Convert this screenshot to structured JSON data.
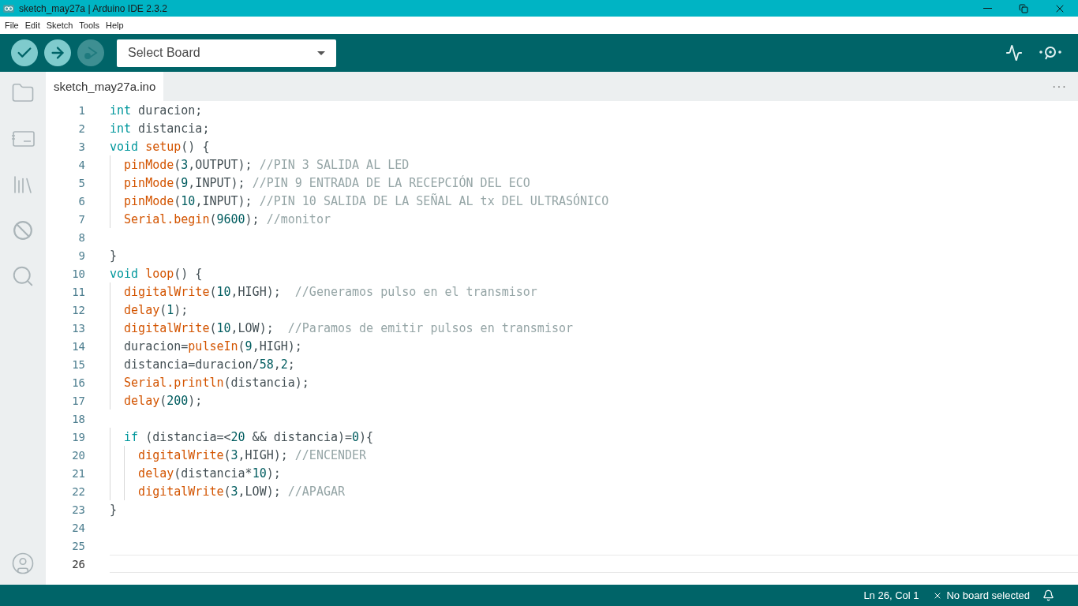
{
  "window": {
    "title": "sketch_may27a | Arduino IDE 2.3.2"
  },
  "menu": [
    "File",
    "Edit",
    "Sketch",
    "Tools",
    "Help"
  ],
  "toolbar": {
    "board_select": "Select Board"
  },
  "tabs": [
    {
      "label": "sketch_may27a.ino",
      "selected": true
    }
  ],
  "tab_bar_more": "···",
  "editor": {
    "lines": [
      {
        "number": "1",
        "current": false,
        "tokens": [
          {
            "kind": "keyword",
            "text": "int"
          },
          {
            "kind": "plain",
            "text": " duracion;"
          }
        ]
      },
      {
        "number": "2",
        "current": false,
        "tokens": [
          {
            "kind": "keyword",
            "text": "int"
          },
          {
            "kind": "plain",
            "text": " distancia;"
          }
        ]
      },
      {
        "number": "3",
        "current": false,
        "tokens": [
          {
            "kind": "keyword",
            "text": "void "
          },
          {
            "kind": "function",
            "text": "setup"
          },
          {
            "kind": "plain",
            "text": "() {"
          }
        ]
      },
      {
        "number": "4",
        "current": false,
        "tokens": [
          {
            "kind": "function",
            "text": "  pinMode"
          },
          {
            "kind": "plain",
            "text": "("
          },
          {
            "kind": "number",
            "text": "3"
          },
          {
            "kind": "plain",
            "text": ",OUTPUT); "
          },
          {
            "kind": "comment",
            "text": "//PIN 3 SALIDA AL LED"
          }
        ]
      },
      {
        "number": "5",
        "current": false,
        "tokens": [
          {
            "kind": "function",
            "text": "  pinMode"
          },
          {
            "kind": "plain",
            "text": "("
          },
          {
            "kind": "number",
            "text": "9"
          },
          {
            "kind": "plain",
            "text": ",INPUT); "
          },
          {
            "kind": "comment",
            "text": "//PIN 9 ENTRADA DE LA RECEPCIÓN DEL ECO"
          }
        ]
      },
      {
        "number": "6",
        "current": false,
        "tokens": [
          {
            "kind": "function",
            "text": "  pinMode"
          },
          {
            "kind": "plain",
            "text": "("
          },
          {
            "kind": "number",
            "text": "10"
          },
          {
            "kind": "plain",
            "text": ",INPUT); "
          },
          {
            "kind": "comment",
            "text": "//PIN 10 SALIDA DE LA SEÑAL AL tx DEL ULTRASÓNICO"
          }
        ]
      },
      {
        "number": "7",
        "current": false,
        "tokens": [
          {
            "kind": "function",
            "text": "  Serial.begin"
          },
          {
            "kind": "plain",
            "text": "("
          },
          {
            "kind": "number",
            "text": "9600"
          },
          {
            "kind": "plain",
            "text": "); "
          },
          {
            "kind": "comment",
            "text": "//monitor"
          }
        ]
      },
      {
        "number": "8",
        "current": false
      },
      {
        "number": "9",
        "current": false,
        "tokens": [
          {
            "kind": "plain",
            "text": "}"
          }
        ]
      },
      {
        "number": "10",
        "current": false,
        "tokens": [
          {
            "kind": "keyword",
            "text": "void "
          },
          {
            "kind": "function",
            "text": "loop"
          },
          {
            "kind": "plain",
            "text": "() {"
          }
        ]
      },
      {
        "number": "11",
        "current": false,
        "tokens": [
          {
            "kind": "function",
            "text": "  digitalWrite"
          },
          {
            "kind": "plain",
            "text": "("
          },
          {
            "kind": "number",
            "text": "10"
          },
          {
            "kind": "plain",
            "text": ",HIGH);  "
          },
          {
            "kind": "comment",
            "text": "//Generamos pulso en el transmisor"
          }
        ]
      },
      {
        "number": "12",
        "current": false,
        "tokens": [
          {
            "kind": "function",
            "text": "  delay"
          },
          {
            "kind": "plain",
            "text": "("
          },
          {
            "kind": "number",
            "text": "1"
          },
          {
            "kind": "plain",
            "text": ");"
          }
        ]
      },
      {
        "number": "13",
        "current": false,
        "tokens": [
          {
            "kind": "function",
            "text": "  digitalWrite"
          },
          {
            "kind": "plain",
            "text": "("
          },
          {
            "kind": "number",
            "text": "10"
          },
          {
            "kind": "plain",
            "text": ",LOW);  "
          },
          {
            "kind": "comment",
            "text": "//Paramos de emitir pulsos en transmisor"
          }
        ]
      },
      {
        "number": "14",
        "current": false,
        "tokens": [
          {
            "kind": "plain",
            "text": "  duracion="
          },
          {
            "kind": "function",
            "text": "pulseIn"
          },
          {
            "kind": "plain",
            "text": "("
          },
          {
            "kind": "number",
            "text": "9"
          },
          {
            "kind": "plain",
            "text": ",HIGH);"
          }
        ]
      },
      {
        "number": "15",
        "current": false,
        "tokens": [
          {
            "kind": "plain",
            "text": "  distancia=duracion/"
          },
          {
            "kind": "number",
            "text": "58"
          },
          {
            "kind": "plain",
            "text": ","
          },
          {
            "kind": "number",
            "text": "2"
          },
          {
            "kind": "plain",
            "text": ";"
          }
        ]
      },
      {
        "number": "16",
        "current": false,
        "tokens": [
          {
            "kind": "function",
            "text": "  Serial.println"
          },
          {
            "kind": "plain",
            "text": "(distancia);"
          }
        ]
      },
      {
        "number": "17",
        "current": false,
        "tokens": [
          {
            "kind": "function",
            "text": "  delay"
          },
          {
            "kind": "plain",
            "text": "("
          },
          {
            "kind": "number",
            "text": "200"
          },
          {
            "kind": "plain",
            "text": ");"
          }
        ]
      },
      {
        "number": "18",
        "current": false
      },
      {
        "number": "19",
        "current": false,
        "tokens": [
          {
            "kind": "keyword",
            "text": "  if"
          },
          {
            "kind": "plain",
            "text": " (distancia=<"
          },
          {
            "kind": "number",
            "text": "20"
          },
          {
            "kind": "plain",
            "text": " && distancia)="
          },
          {
            "kind": "number",
            "text": "0"
          },
          {
            "kind": "plain",
            "text": "){"
          }
        ]
      },
      {
        "number": "20",
        "current": false,
        "tokens": [
          {
            "kind": "function",
            "text": "    digitalWrite"
          },
          {
            "kind": "plain",
            "text": "("
          },
          {
            "kind": "number",
            "text": "3"
          },
          {
            "kind": "plain",
            "text": ",HIGH); "
          },
          {
            "kind": "comment",
            "text": "//ENCENDER"
          }
        ]
      },
      {
        "number": "21",
        "current": false,
        "tokens": [
          {
            "kind": "function",
            "text": "    delay"
          },
          {
            "kind": "plain",
            "text": "(distancia*"
          },
          {
            "kind": "number",
            "text": "10"
          },
          {
            "kind": "plain",
            "text": ");"
          }
        ]
      },
      {
        "number": "22",
        "current": false,
        "tokens": [
          {
            "kind": "function",
            "text": "    digitalWrite"
          },
          {
            "kind": "plain",
            "text": "("
          },
          {
            "kind": "number",
            "text": "3"
          },
          {
            "kind": "plain",
            "text": ",LOW); "
          },
          {
            "kind": "comment",
            "text": "//APAGAR"
          }
        ]
      },
      {
        "number": "23",
        "current": false,
        "tokens": [
          {
            "kind": "plain",
            "text": "}"
          }
        ]
      },
      {
        "number": "24",
        "current": false
      },
      {
        "number": "25",
        "current": false
      },
      {
        "number": "26",
        "current": true
      }
    ]
  },
  "status_bar": {
    "position": "Ln 26, Col 1",
    "board": "No board selected"
  }
}
